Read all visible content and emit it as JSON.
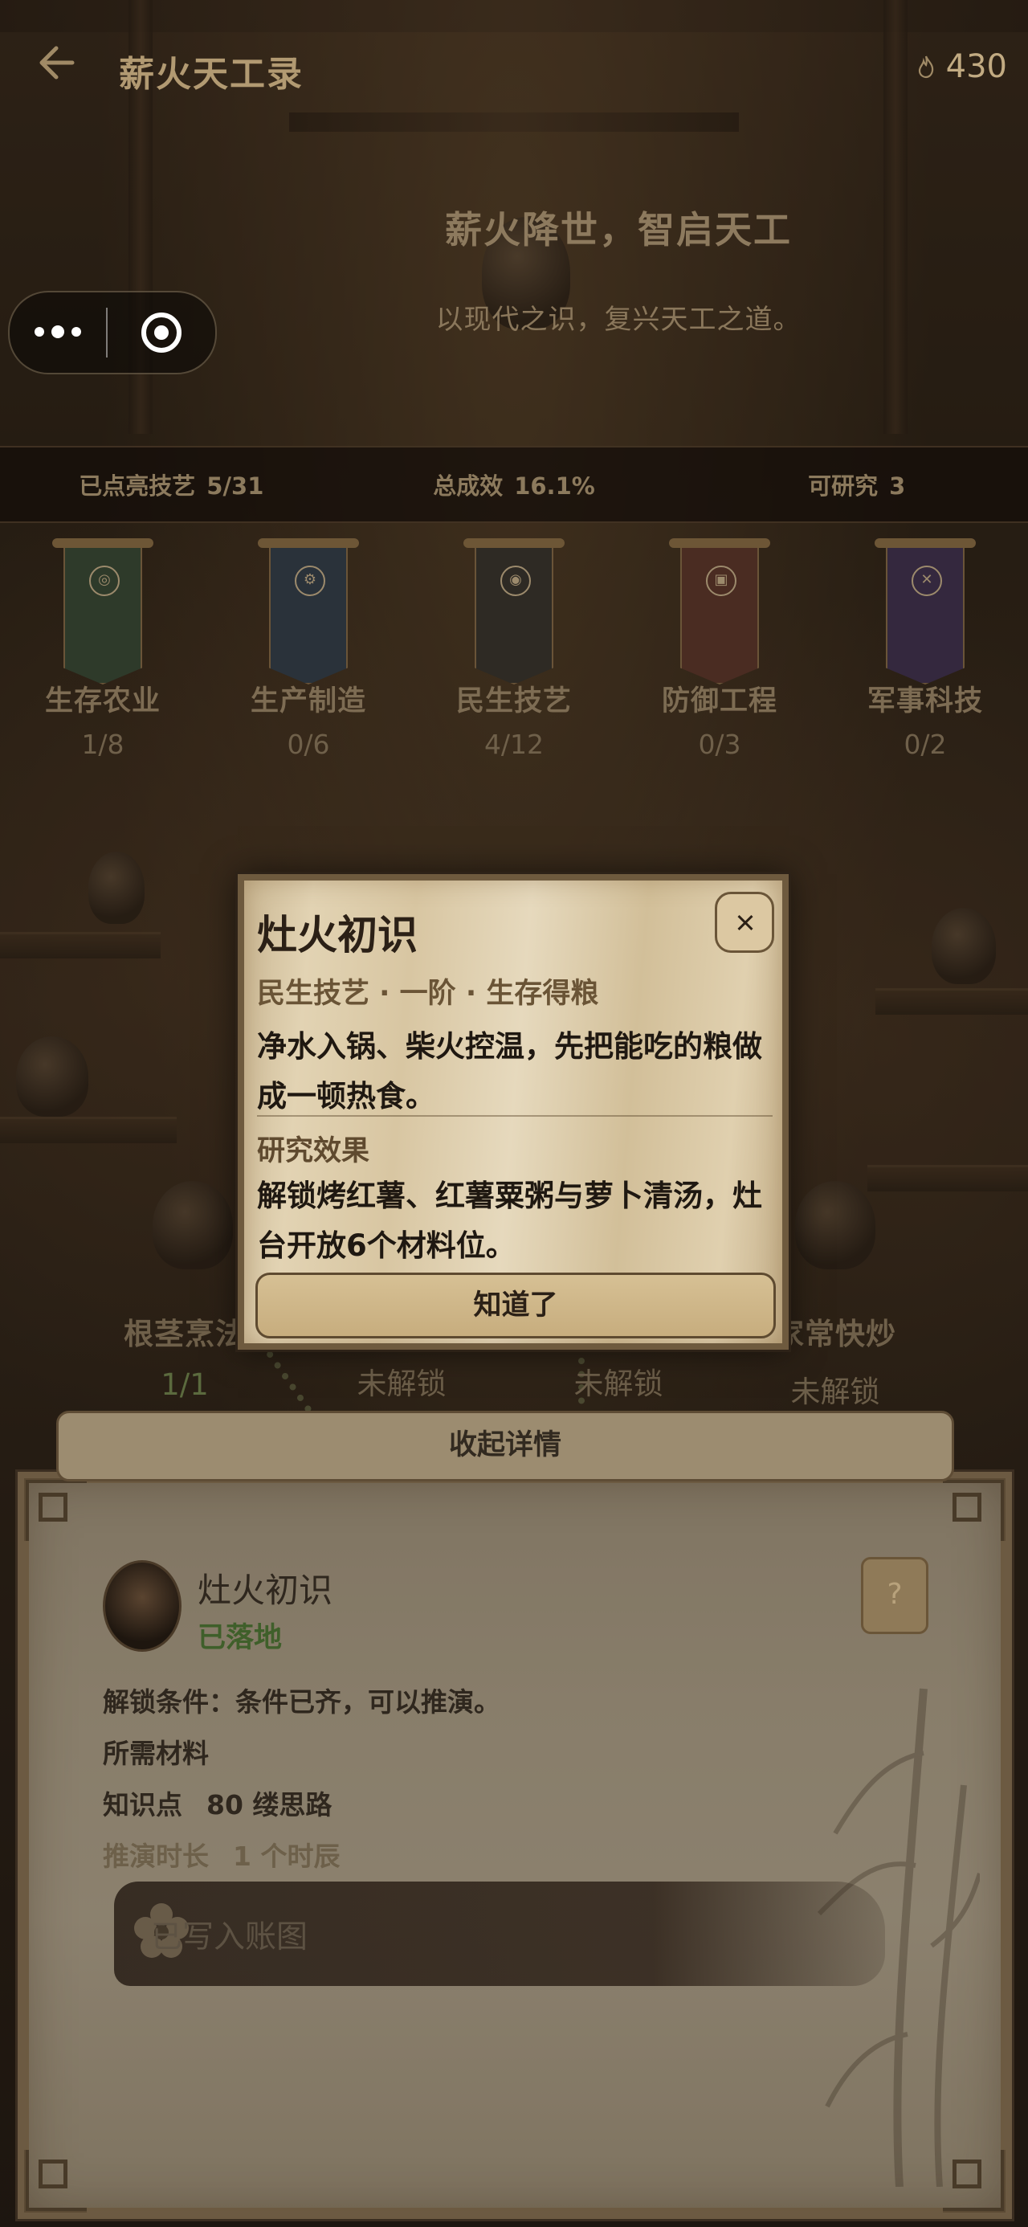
{
  "header": {
    "title": "薪火天工录",
    "currency_value": "430"
  },
  "hero": {
    "title": "薪火降世，智启天工",
    "subtitle": "以现代之识，复兴天工之道。"
  },
  "stats": [
    {
      "label": "已点亮技艺",
      "value": "5/31"
    },
    {
      "label": "总成效",
      "value": "16.1%"
    },
    {
      "label": "可研究",
      "value": "3"
    }
  ],
  "categories": [
    {
      "name": "生存农业",
      "count": "1/8",
      "color": "#2e3a2a",
      "emblem": "◎"
    },
    {
      "name": "生产制造",
      "count": "0/6",
      "color": "#2a323a",
      "emblem": "⚙"
    },
    {
      "name": "民生技艺",
      "count": "4/12",
      "color": "#2e2a24",
      "emblem": "◉"
    },
    {
      "name": "防御工程",
      "count": "0/3",
      "color": "#4a2c22",
      "emblem": "▣"
    },
    {
      "name": "军事科技",
      "count": "0/2",
      "color": "#34283e",
      "emblem": "✕"
    }
  ],
  "nodes": [
    {
      "name": "根茎烹法",
      "state": "1/1",
      "done": true
    },
    {
      "name": "",
      "state": "未解锁",
      "done": false
    },
    {
      "name": "",
      "state": "未解锁",
      "done": false
    },
    {
      "name": "家常快炒",
      "state": "未解锁",
      "done": false
    }
  ],
  "detail": {
    "title": "灶火初识",
    "status": "已落地",
    "unlock_label": "解锁条件：",
    "unlock_text": "条件已齐，可以推演。",
    "materials_label": "所需材料",
    "knowledge_label": "知识点",
    "knowledge_value": "80 缕思路",
    "duration_label": "推演时长",
    "duration_value": "1 个时辰",
    "recorded_label": "已写入账图",
    "collapse_label": "收起详情",
    "help_label": "?"
  },
  "modal": {
    "title": "灶火初识",
    "meta": "民生技艺 · 一阶 · 生存得粮",
    "description": "净水入锅、柴火控温，先把能吃的粮做成一顿热食。",
    "effect_title": "研究效果",
    "effect_text": "解锁烤红薯、红薯粟粥与萝卜清汤，灶台开放6个材料位。",
    "ok_label": "知道了"
  },
  "colors": {
    "accent_gold": "#c2ab82",
    "success_green": "#3f5f2a",
    "modal_paper": "#e2d3b3"
  }
}
